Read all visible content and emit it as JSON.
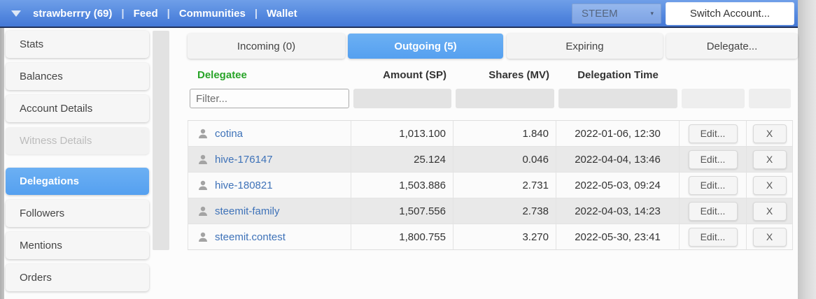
{
  "topbar": {
    "account": "strawberrry (69)",
    "separator": "|",
    "nav": [
      {
        "label": "Feed"
      },
      {
        "label": "Communities"
      },
      {
        "label": "Wallet"
      }
    ],
    "network_select": {
      "value": "STEEM",
      "caret": "▾"
    },
    "switch_account_label": "Switch Account..."
  },
  "sidebar": {
    "items": [
      {
        "label": "Stats",
        "state": "normal"
      },
      {
        "label": "Balances",
        "state": "normal"
      },
      {
        "label": "Account Details",
        "state": "normal"
      },
      {
        "label": "Witness Details",
        "state": "disabled"
      },
      {
        "label": "Delegations",
        "state": "selected"
      },
      {
        "label": "Followers",
        "state": "normal"
      },
      {
        "label": "Mentions",
        "state": "normal"
      },
      {
        "label": "Orders",
        "state": "normal"
      }
    ]
  },
  "tabs": [
    {
      "label": "Incoming (0)",
      "selected": false
    },
    {
      "label": "Outgoing (5)",
      "selected": true
    },
    {
      "label": "Expiring",
      "selected": false
    }
  ],
  "delegate_button_label": "Delegate...",
  "table": {
    "columns": [
      "Delegatee",
      "Amount (SP)",
      "Shares (MV)",
      "Delegation Time"
    ],
    "filter_placeholder": "Filter...",
    "row_actions": {
      "edit_label": "Edit...",
      "remove_label": "X"
    },
    "rows": [
      {
        "delegatee": "cotina",
        "amount": "1,013.100",
        "shares": "1.840",
        "time": "2022-01-06, 12:30"
      },
      {
        "delegatee": "hive-176147",
        "amount": "25.124",
        "shares": "0.046",
        "time": "2022-04-04, 13:46"
      },
      {
        "delegatee": "hive-180821",
        "amount": "1,503.886",
        "shares": "2.731",
        "time": "2022-05-03, 09:24"
      },
      {
        "delegatee": "steemit-family",
        "amount": "1,507.556",
        "shares": "2.738",
        "time": "2022-04-03, 14:23"
      },
      {
        "delegatee": "steemit.contest",
        "amount": "1,800.755",
        "shares": "3.270",
        "time": "2022-05-30, 23:41"
      }
    ]
  },
  "colors": {
    "topbar_blue": "#5589df",
    "selected_blue": "#55a0f0",
    "link_blue": "#3e72b8",
    "delegatee_green": "#28a428"
  }
}
